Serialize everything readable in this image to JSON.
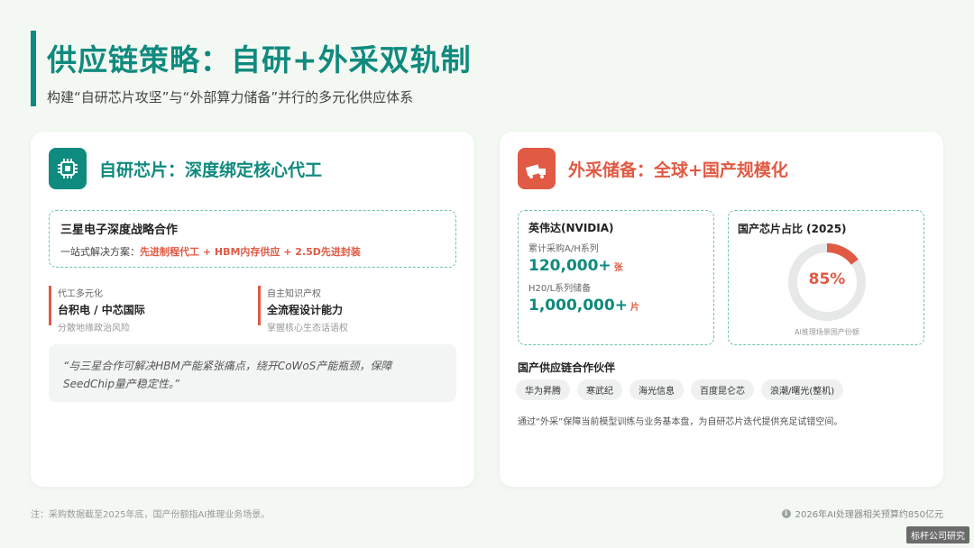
{
  "header": {
    "title": "供应链策略：自研+外采双轨制",
    "subtitle": "构建“自研芯片攻坚”与“外部算力储备”并行的多元化供应体系"
  },
  "left_card": {
    "icon": "chip-icon",
    "title": "自研芯片：深度绑定核心代工",
    "samsung": {
      "title": "三星电子深度战略合作",
      "label": "一站式解决方案：",
      "highlight": "先进制程代工 + HBM内存供应 + 2.5D先进封装"
    },
    "stats": [
      {
        "tag": "代工多元化",
        "main": "台积电 / 中芯国际",
        "sub": "分散地缘政治风险"
      },
      {
        "tag": "自主知识产权",
        "main": "全流程设计能力",
        "sub": "掌握核心生态话语权"
      }
    ],
    "quote": "“与三星合作可解决HBM产能紧张痛点，绕开CoWoS产能瓶颈，保障SeedChip量产稳定性。”"
  },
  "right_card": {
    "icon": "truck-icon",
    "title": "外采储备：全球+国产规模化",
    "nvidia": {
      "title": "英伟达(NVIDIA)",
      "label1": "累计采购A/H系列",
      "value1": "120,000+",
      "unit1": "张",
      "label2": "H20/L系列储备",
      "value2": "1,000,000+",
      "unit2": "片"
    },
    "share": {
      "title": "国产芯片占比 (2025)",
      "percent": 85,
      "percent_label": "85%",
      "note": "AI推理场景国产份额",
      "color_fill": "#e05a44",
      "color_track": "#e6e9e8"
    },
    "partners_title": "国产供应链合作伙伴",
    "partners": [
      "华为昇腾",
      "寒武纪",
      "海光信息",
      "百度昆仑芯",
      "浪潮/曙光(整机)"
    ],
    "note": "通过“外采”保障当前模型训练与业务基本盘，为自研芯片迭代提供充足试错空间。"
  },
  "footer": {
    "left": "注：采购数据截至2025年底，国产份额指AI推理业务场景。",
    "right_icon": "info-icon",
    "right": "2026年AI处理器相关预算约850亿元"
  },
  "watermark": "标杆公司研究",
  "colors": {
    "accent": "#0f8a7e",
    "highlight": "#e05a44",
    "background": "#f4f8f3"
  }
}
